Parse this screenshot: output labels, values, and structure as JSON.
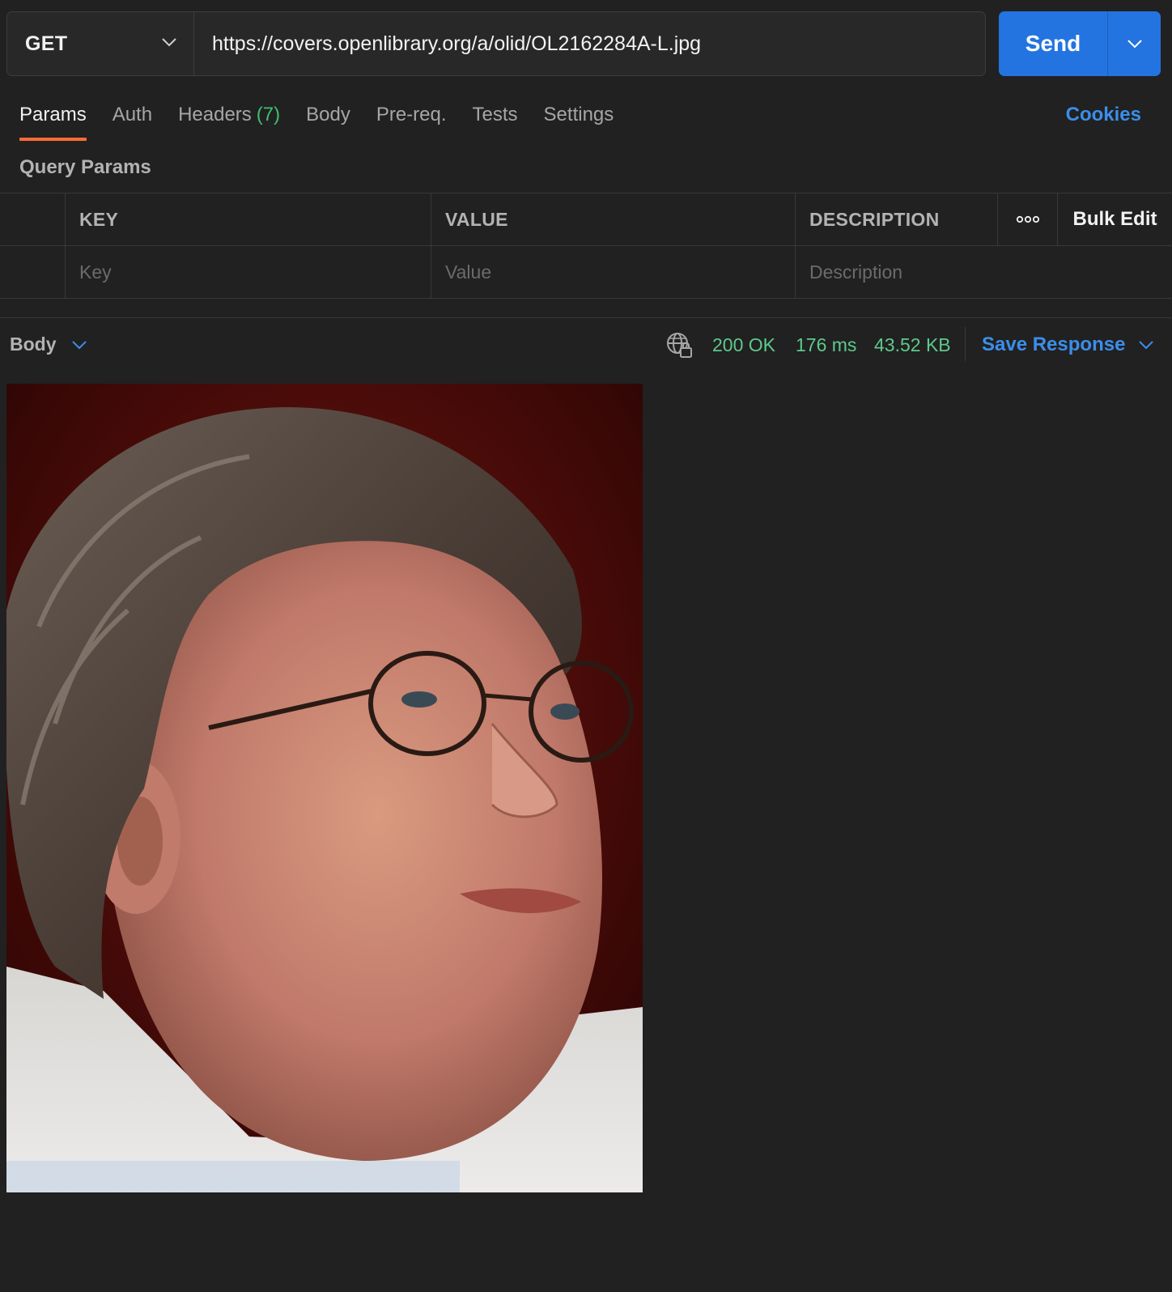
{
  "request": {
    "method": "GET",
    "url": "https://covers.openlibrary.org/a/olid/OL2162284A-L.jpg",
    "send_label": "Send"
  },
  "tabs": [
    {
      "label": "Params",
      "active": true
    },
    {
      "label": "Auth"
    },
    {
      "label": "Headers",
      "count": "(7)"
    },
    {
      "label": "Body"
    },
    {
      "label": "Pre-req."
    },
    {
      "label": "Tests"
    },
    {
      "label": "Settings"
    }
  ],
  "cookies_label": "Cookies",
  "query_params": {
    "title": "Query Params",
    "headers": [
      "KEY",
      "VALUE",
      "DESCRIPTION"
    ],
    "more_icon": "more-horizontal-icon",
    "bulk_edit_label": "Bulk Edit",
    "placeholders": {
      "key": "Key",
      "value": "Value",
      "description": "Description"
    }
  },
  "response": {
    "body_label": "Body",
    "status": "200 OK",
    "time": "176 ms",
    "size": "43.52 KB",
    "save_label": "Save Response",
    "status_color": "#5ec98c"
  },
  "colors": {
    "accent_orange": "#ff6c37",
    "primary_blue": "#2374e1",
    "link_blue": "#3b8eea",
    "green": "#3fbf6f"
  }
}
